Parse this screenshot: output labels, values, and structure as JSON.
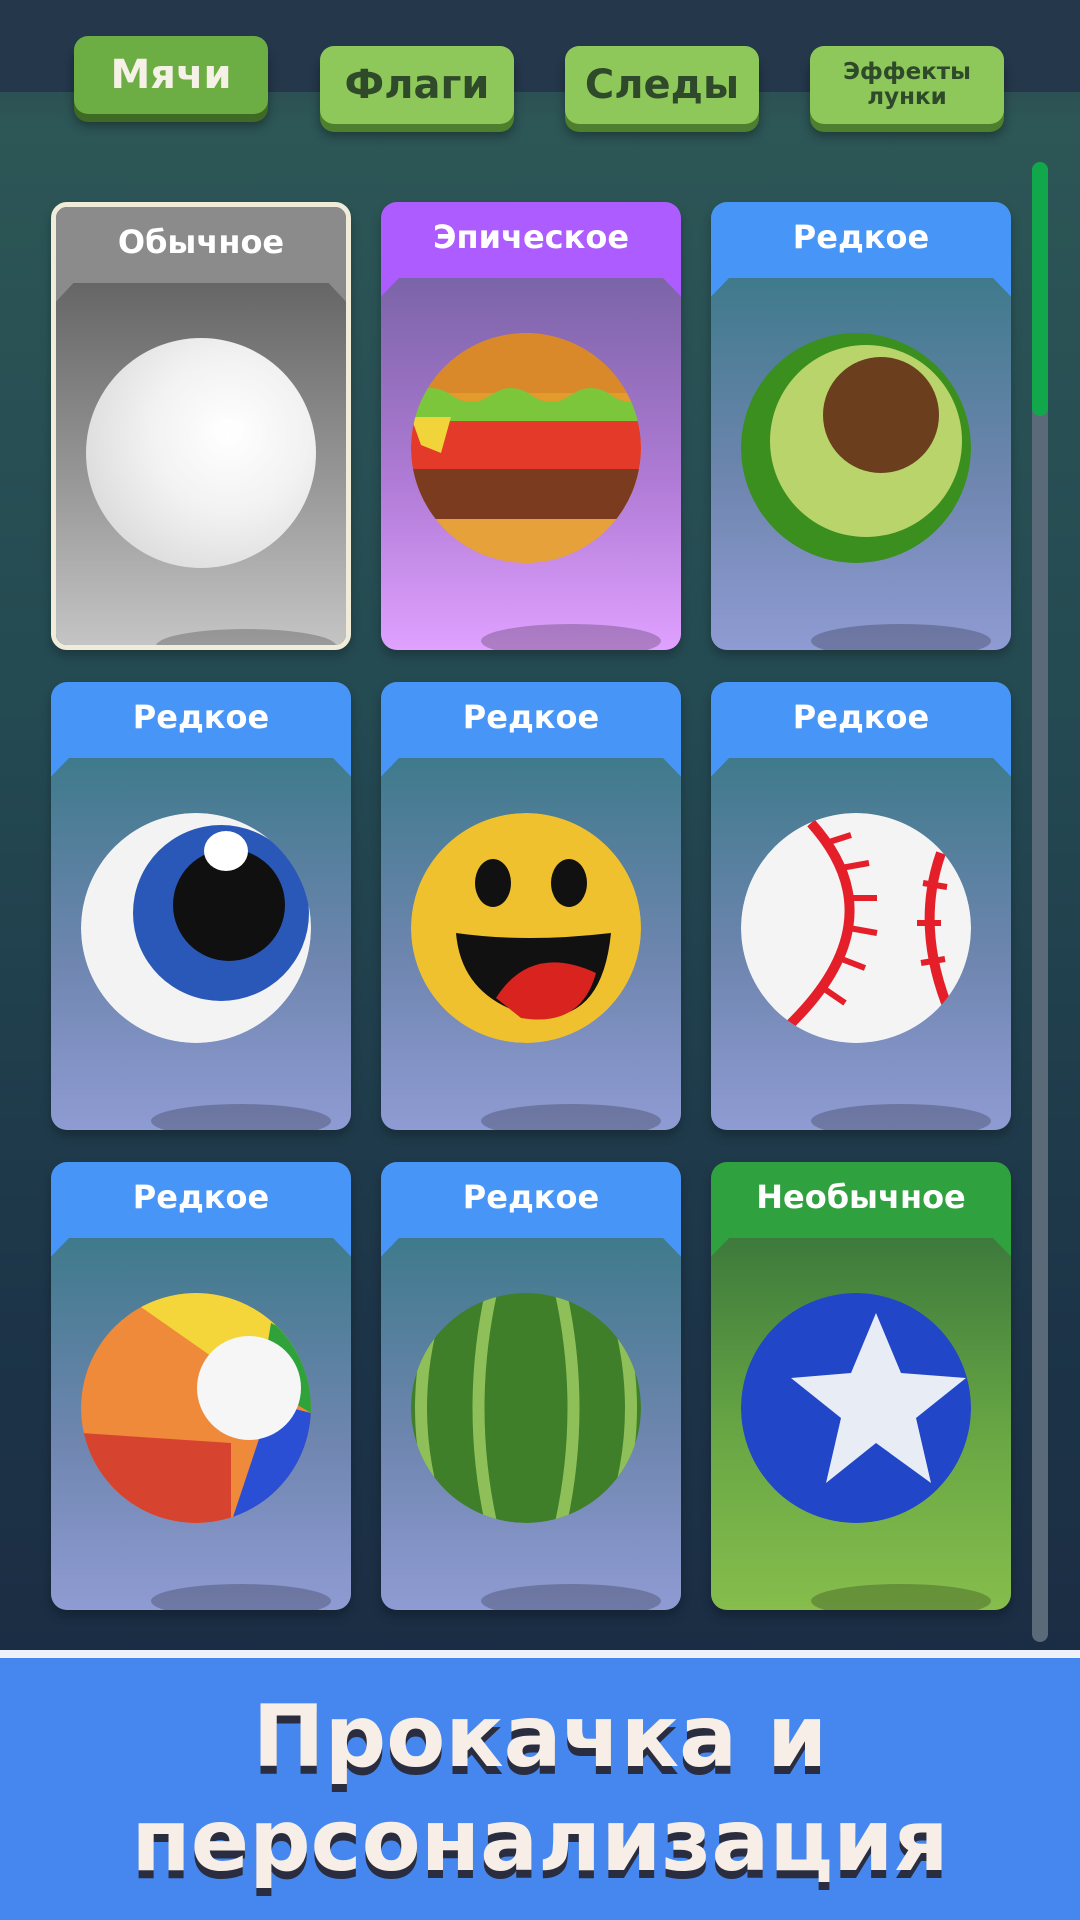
{
  "tabs": [
    {
      "label": "Мячи",
      "active": true
    },
    {
      "label": "Флаги",
      "active": false
    },
    {
      "label": "Следы",
      "active": false
    },
    {
      "label": "Эффекты лунки",
      "active": false
    }
  ],
  "cards": [
    {
      "rarity": "Обычное",
      "ball": "white-ball"
    },
    {
      "rarity": "Эпическое",
      "ball": "burger-ball"
    },
    {
      "rarity": "Редкое",
      "ball": "avocado-ball"
    },
    {
      "rarity": "Редкое",
      "ball": "eye-ball"
    },
    {
      "rarity": "Редкое",
      "ball": "smiley-ball"
    },
    {
      "rarity": "Редкое",
      "ball": "baseball-ball"
    },
    {
      "rarity": "Редкое",
      "ball": "beach-ball"
    },
    {
      "rarity": "Редкое",
      "ball": "watermelon-ball"
    },
    {
      "rarity": "Необычное",
      "ball": "star-ball"
    }
  ],
  "banner": {
    "title": "Прокачка и персонализация"
  },
  "colors": {
    "common": "#8b8b8b",
    "epic": "#ad5cff",
    "rare": "#4795f6",
    "uncommon": "#2fa13f",
    "scroll_thumb": "#10a84a",
    "banner": "#4687ef"
  }
}
